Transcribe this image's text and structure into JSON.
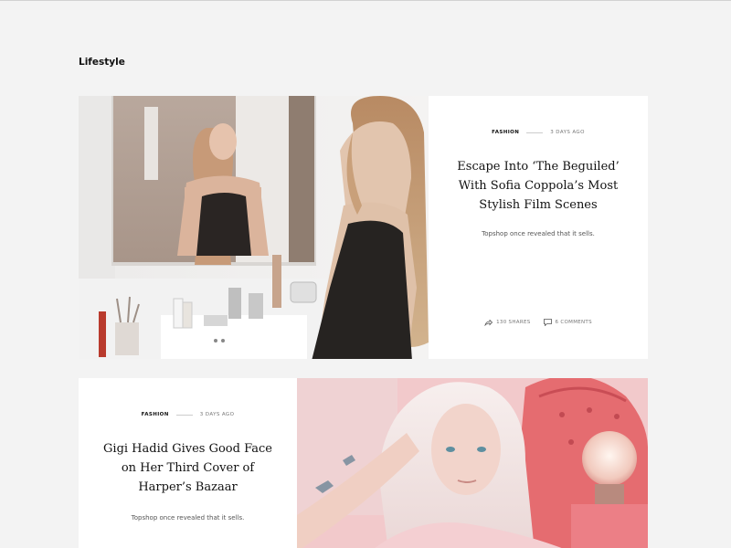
{
  "section": {
    "title": "Lifestyle"
  },
  "articles": [
    {
      "category": "Fashion",
      "time_ago": "3 days ago",
      "title": "Escape Into ‘The Beguiled’ With Sofia Coppola’s Most Stylish Film Scenes",
      "excerpt": "Topshop once revealed that it sells.",
      "shares": "130 SHARES",
      "comments": "6 COMMENTS",
      "image_alt": "woman-mirror-photo"
    },
    {
      "category": "Fashion",
      "time_ago": "3 days ago",
      "title": "Gigi Hadid Gives Good Face on Her Third Cover of Harper’s Bazaar",
      "excerpt": "Topshop once revealed that it sells.",
      "image_alt": "blonde-woman-photo"
    }
  ],
  "icons": {
    "share": "share-icon",
    "comment": "comment-icon"
  }
}
